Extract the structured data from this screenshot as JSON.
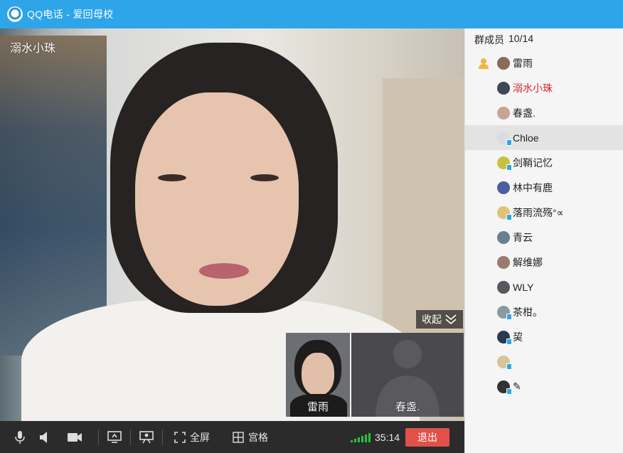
{
  "window": {
    "app_name": "QQ电话",
    "separator": "-",
    "group_name": "爱回母校"
  },
  "video": {
    "speaker_name": "溺水小珠",
    "collapse_label": "收起",
    "thumbnails": [
      {
        "name": "雷雨"
      },
      {
        "name": "春盏."
      }
    ]
  },
  "toolbar": {
    "fullscreen_label": "全屏",
    "grid_label": "宫格",
    "timer": "35:14",
    "exit_label": "退出"
  },
  "members": {
    "header_label": "群成员",
    "count": "10/14",
    "list": [
      {
        "name": "雷雨",
        "color": "#222222",
        "avatar": "#8a6a5a",
        "host": true
      },
      {
        "name": "溺水小珠",
        "color": "#e02020",
        "avatar": "#3c4a55"
      },
      {
        "name": "春盏.",
        "color": "#222222",
        "avatar": "#c7a496"
      },
      {
        "name": "Chloe",
        "color": "#222222",
        "avatar": "#d8dde3",
        "device": true
      },
      {
        "name": "剑鞘记忆",
        "color": "#222222",
        "avatar": "#c9c040",
        "device": true
      },
      {
        "name": "林中有鹿",
        "color": "#222222",
        "avatar": "#4b5fa0"
      },
      {
        "name": "落雨流殇°∝",
        "color": "#222222",
        "avatar": "#e2c27a",
        "device": true
      },
      {
        "name": "青云",
        "color": "#222222",
        "avatar": "#6a7f8d"
      },
      {
        "name": "解维娜",
        "color": "#222222",
        "avatar": "#9a7a6a"
      },
      {
        "name": "WLY",
        "color": "#222222",
        "avatar": "#55585c"
      },
      {
        "name": "茶柑。",
        "color": "#222222",
        "avatar": "#8a9aa0",
        "device": true
      },
      {
        "name": "巭",
        "color": "#222222",
        "avatar": "#2a3a55",
        "device": true
      },
      {
        "name": "",
        "color": "#222222",
        "avatar": "#d8c49a",
        "device": true
      },
      {
        "name": "✎",
        "color": "#222222",
        "avatar": "#333333",
        "device": true
      }
    ]
  }
}
